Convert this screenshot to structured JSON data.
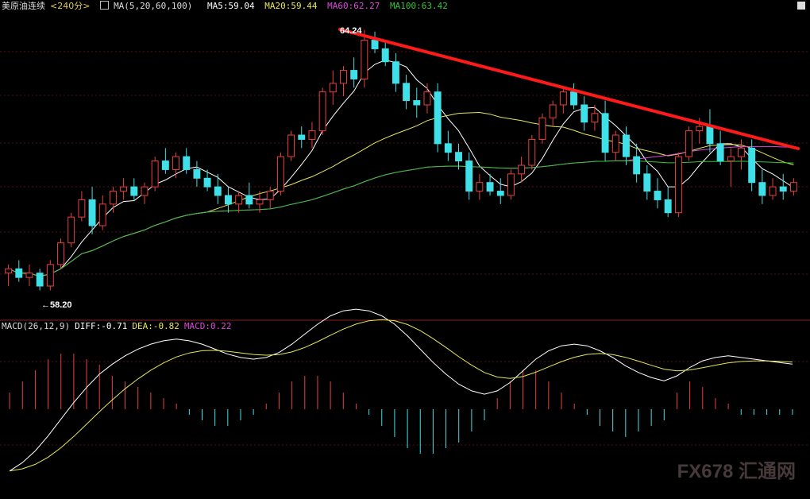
{
  "header": {
    "title": "美原油连续",
    "period": "<240分>",
    "ma_label": "MA(5,20,60,100)",
    "ma5": "MA5:59.04",
    "ma20": "MA20:59.44",
    "ma60": "MA60:62.27",
    "ma100": "MA100:63.42"
  },
  "macd_header": {
    "label": "MACD(26,12,9)",
    "diff": "DIFF:-0.71",
    "dea": "DEA:-0.82",
    "macd": "MACD:0.22"
  },
  "annotations": {
    "high": "64.24",
    "low": "←58.20"
  },
  "watermark": "FX678 汇通网",
  "colors": {
    "bg": "#000000",
    "up": "#e8413e",
    "down": "#40e0e8",
    "ma5": "#ffffff",
    "ma20": "#e6e65a",
    "ma60": "#d94ad9",
    "ma100": "#35c435",
    "trend": "#ff1a1a",
    "grid": "#5a1010",
    "diff": "#ffffff",
    "dea": "#e6e65a"
  },
  "chart_data": [
    {
      "type": "candlestick",
      "ylim": [
        57.6,
        64.6
      ],
      "candles": [
        [
          58.6,
          58.8,
          58.3,
          58.7
        ],
        [
          58.7,
          58.9,
          58.4,
          58.5
        ],
        [
          58.5,
          58.8,
          58.3,
          58.6
        ],
        [
          58.6,
          58.7,
          58.2,
          58.3
        ],
        [
          58.3,
          58.9,
          58.2,
          58.8
        ],
        [
          58.8,
          59.4,
          58.7,
          59.3
        ],
        [
          59.3,
          60.0,
          59.2,
          59.9
        ],
        [
          59.9,
          60.5,
          59.8,
          60.3
        ],
        [
          60.3,
          60.6,
          59.5,
          59.7
        ],
        [
          59.7,
          60.4,
          59.6,
          60.2
        ],
        [
          60.2,
          60.6,
          60.0,
          60.5
        ],
        [
          60.5,
          60.8,
          60.3,
          60.6
        ],
        [
          60.6,
          60.8,
          60.3,
          60.4
        ],
        [
          60.4,
          60.7,
          60.2,
          60.6
        ],
        [
          60.6,
          61.3,
          60.5,
          61.2
        ],
        [
          61.2,
          61.5,
          60.9,
          61.0
        ],
        [
          61.0,
          61.4,
          60.8,
          61.3
        ],
        [
          61.3,
          61.5,
          60.9,
          61.0
        ],
        [
          61.0,
          61.2,
          60.6,
          60.8
        ],
        [
          60.8,
          61.0,
          60.5,
          60.6
        ],
        [
          60.6,
          60.9,
          60.2,
          60.4
        ],
        [
          60.4,
          60.6,
          60.0,
          60.2
        ],
        [
          60.2,
          60.5,
          60.0,
          60.4
        ],
        [
          60.4,
          60.7,
          60.1,
          60.2
        ],
        [
          60.2,
          60.5,
          60.0,
          60.3
        ],
        [
          60.3,
          60.6,
          60.1,
          60.5
        ],
        [
          60.5,
          61.4,
          60.4,
          61.3
        ],
        [
          61.3,
          61.9,
          61.2,
          61.8
        ],
        [
          61.8,
          62.0,
          61.5,
          61.7
        ],
        [
          61.7,
          62.1,
          61.5,
          61.9
        ],
        [
          61.9,
          62.9,
          61.8,
          62.8
        ],
        [
          62.8,
          63.3,
          62.5,
          63.0
        ],
        [
          63.0,
          63.4,
          62.7,
          63.3
        ],
        [
          63.3,
          63.6,
          62.9,
          63.1
        ],
        [
          63.1,
          64.24,
          62.9,
          64.0
        ],
        [
          64.0,
          64.2,
          63.7,
          63.8
        ],
        [
          63.8,
          64.0,
          63.4,
          63.5
        ],
        [
          63.5,
          63.7,
          62.8,
          63.0
        ],
        [
          63.0,
          63.2,
          62.4,
          62.6
        ],
        [
          62.6,
          62.9,
          62.2,
          62.5
        ],
        [
          62.5,
          63.0,
          62.3,
          62.8
        ],
        [
          62.8,
          63.0,
          61.4,
          61.6
        ],
        [
          61.6,
          61.9,
          61.2,
          61.4
        ],
        [
          61.4,
          61.6,
          61.0,
          61.2
        ],
        [
          61.2,
          61.4,
          60.3,
          60.5
        ],
        [
          60.5,
          60.9,
          60.3,
          60.7
        ],
        [
          60.7,
          60.9,
          60.4,
          60.5
        ],
        [
          60.5,
          60.8,
          60.2,
          60.4
        ],
        [
          60.4,
          61.0,
          60.3,
          60.9
        ],
        [
          60.9,
          61.3,
          60.7,
          61.1
        ],
        [
          61.1,
          61.8,
          61.0,
          61.7
        ],
        [
          61.7,
          62.3,
          61.6,
          62.2
        ],
        [
          62.2,
          62.6,
          62.0,
          62.5
        ],
        [
          62.5,
          62.9,
          62.3,
          62.8
        ],
        [
          62.8,
          63.0,
          62.4,
          62.5
        ],
        [
          62.5,
          62.7,
          61.9,
          62.1
        ],
        [
          62.1,
          62.5,
          61.9,
          62.3
        ],
        [
          62.3,
          62.6,
          61.2,
          61.4
        ],
        [
          61.4,
          61.9,
          61.2,
          61.8
        ],
        [
          61.8,
          62.0,
          61.1,
          61.3
        ],
        [
          61.3,
          61.6,
          60.7,
          60.9
        ],
        [
          60.9,
          61.1,
          60.3,
          60.5
        ],
        [
          60.5,
          60.8,
          60.1,
          60.3
        ],
        [
          60.3,
          60.6,
          59.9,
          60.0
        ],
        [
          60.0,
          61.4,
          59.9,
          61.3
        ],
        [
          61.3,
          62.0,
          61.2,
          61.9
        ],
        [
          61.9,
          62.2,
          61.6,
          62.0
        ],
        [
          62.0,
          62.4,
          61.4,
          61.6
        ],
        [
          61.6,
          61.9,
          61.1,
          61.2
        ],
        [
          61.2,
          61.5,
          60.6,
          61.3
        ],
        [
          61.3,
          61.7,
          61.0,
          61.5
        ],
        [
          61.5,
          61.7,
          60.5,
          60.7
        ],
        [
          60.7,
          61.0,
          60.2,
          60.4
        ],
        [
          60.4,
          60.8,
          60.3,
          60.6
        ],
        [
          60.6,
          60.9,
          60.3,
          60.5
        ],
        [
          60.5,
          60.8,
          60.4,
          60.7
        ]
      ]
    },
    {
      "type": "bar",
      "name": "MACD",
      "ylim": [
        -1.3,
        1.3
      ],
      "values": [
        0.3,
        0.5,
        0.7,
        0.9,
        1.0,
        1.0,
        0.9,
        0.8,
        0.6,
        0.5,
        0.4,
        0.3,
        0.2,
        0.1,
        -0.1,
        -0.2,
        -0.3,
        -0.3,
        -0.2,
        -0.1,
        0.1,
        0.3,
        0.5,
        0.6,
        0.6,
        0.5,
        0.3,
        0.1,
        -0.1,
        -0.3,
        -0.5,
        -0.7,
        -0.8,
        -0.8,
        -0.7,
        -0.6,
        -0.4,
        -0.2,
        0.2,
        0.5,
        0.7,
        0.7,
        0.5,
        0.3,
        0.1,
        -0.1,
        -0.3,
        -0.4,
        -0.5,
        -0.4,
        -0.3,
        -0.2,
        0.3,
        0.5,
        0.4,
        0.2,
        0.1,
        -0.1,
        -0.1,
        -0.1,
        -0.1,
        -0.1
      ]
    }
  ]
}
